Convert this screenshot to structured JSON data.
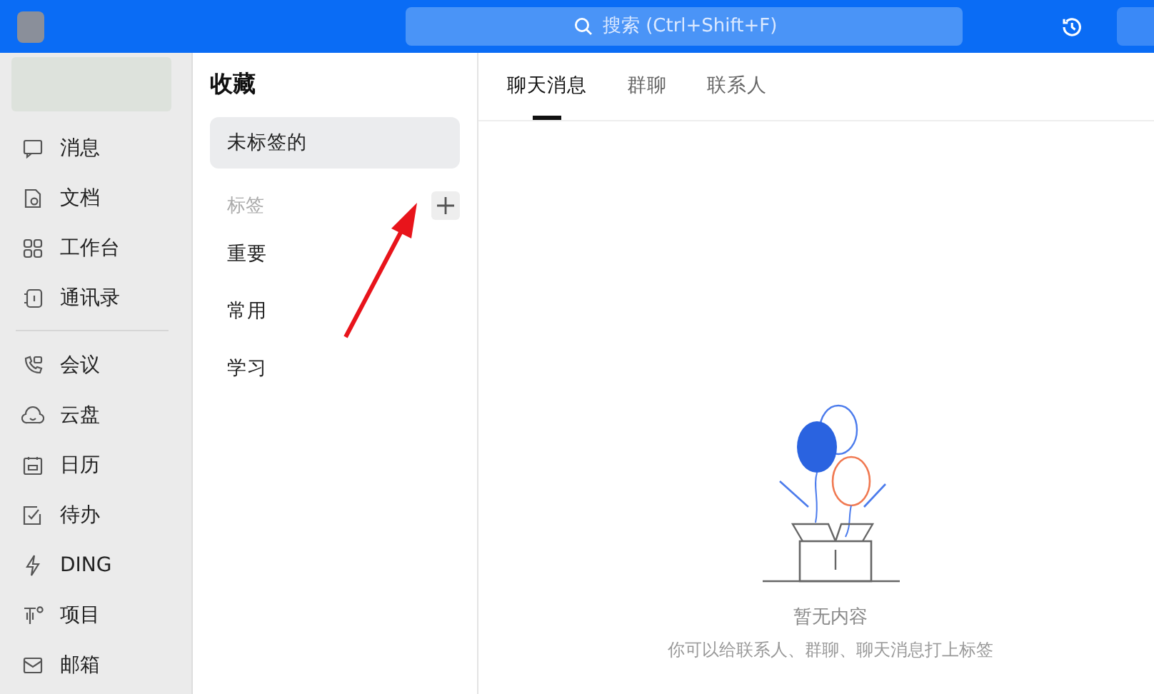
{
  "search": {
    "placeholder": "搜索 (Ctrl+Shift+F)"
  },
  "nav": {
    "main": [
      "消息",
      "文档",
      "工作台",
      "通讯录"
    ],
    "more": [
      "会议",
      "云盘",
      "日历",
      "待办",
      "DING",
      "项目",
      "邮箱"
    ]
  },
  "favorites": {
    "title": "收藏",
    "untagged": {
      "label": "未标签的",
      "selected": true
    },
    "tags_heading": "标签",
    "tags": [
      {
        "label": "重要",
        "selected": false
      },
      {
        "label": "常用",
        "selected": false
      },
      {
        "label": "学习",
        "selected": false
      }
    ]
  },
  "tabs": [
    {
      "label": "聊天消息",
      "selected": true
    },
    {
      "label": "群聊",
      "selected": false
    },
    {
      "label": "联系人",
      "selected": false
    }
  ],
  "empty": {
    "title": "暂无内容",
    "hint": "你可以给联系人、群聊、聊天消息打上标签"
  }
}
